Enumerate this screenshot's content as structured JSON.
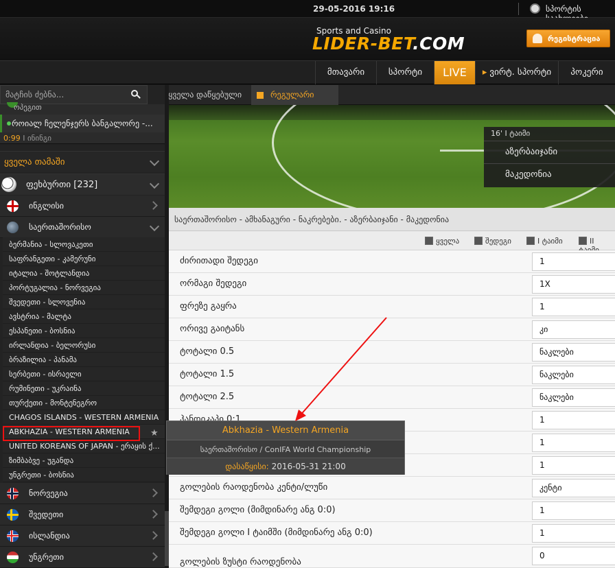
{
  "topbar": {
    "datetime": "29-05-2016 19:16",
    "sports_score": "სპორტის საახლეები"
  },
  "header": {
    "logo_sub": "Sports and Casino",
    "logo_main": "LIDER-BET",
    "logo_com": ".COM",
    "register": "რეგისტრაცია"
  },
  "nav": {
    "items": [
      "მთავარი",
      "სპორტი",
      "LIVE",
      "ვირტ. სპორტი",
      "პოკერი"
    ]
  },
  "search": {
    "placeholder": "მატჩის ძებნა..."
  },
  "filter": {
    "all_sorted": "ყველა დაწყებული",
    "regular": "რეგულარი თამაში"
  },
  "live": {
    "prev": "ოპეგით",
    "match": "როიალ ჩელენჯერს ბანგალორე -...",
    "odds_val": "0:99",
    "odds_suffix": "I ინინგი"
  },
  "sidebar": {
    "all_games": "ყველა თამაში",
    "football": "ფეხბურთი [232]",
    "england": "ინგლისი",
    "international": "საერთაშორისო",
    "matches": [
      "ბერმანია - სლოვაკეთი",
      "საფრანგეთი - კამერუნი",
      "იტალია - შოტლანდია",
      "პორტუგალია - ნორვეგია",
      "შვედეთი - სლოვენია",
      "ავსტრია - მალტა",
      "ესპანეთი - ბოსნია",
      "ირლანდია - ბელორუსი",
      "ბრაზილია - პანამა",
      "სერბეთი - ისრაელი",
      "რუმინეთი - უკრაინა",
      "თურქეთი - მონტენეგრო",
      "CHAGOS ISLANDS - WESTERN ARMENIA",
      "ABKHAZIA - WESTERN ARMENIA",
      "UNITED KOREANS OF JAPAN - ერაყის ქ...",
      "ზიმბაბვე - უგანდა",
      "უნგრეთი - ბოსნია"
    ],
    "norway": "ნორვეგია",
    "sweden": "შვედეთი",
    "iceland": "ისლანდია",
    "hungary": "უნგრეთი"
  },
  "scoreboard": {
    "time": "16'  I ტაიმი",
    "team1": "აზერბაიჯანი",
    "team2": "მაკედონია"
  },
  "breadcrumb": "საერთაშორისო - ამხანაგური - ნაკრებები. - აზერბაიჯანი - მაკედონია",
  "checks": [
    "ყველა",
    "შედეგი",
    "I ტაიმი",
    "II ტაიმი"
  ],
  "markets": [
    {
      "label": "ძირითადი შედეგი",
      "value": "1"
    },
    {
      "label": "ორმაგი შედეგი",
      "value": "1X"
    },
    {
      "label": "ფრეზე გაყრა",
      "value": "1"
    },
    {
      "label": "ორივე გაიტანს",
      "value": "კი"
    },
    {
      "label": "ტოტალი 0.5",
      "value": "ნაკლები"
    },
    {
      "label": "ტოტალი 1.5",
      "value": "ნაკლები"
    },
    {
      "label": "ტოტალი 2.5",
      "value": "ნაკლები"
    },
    {
      "label": "ჰანდიკაპი 0:1",
      "value": "1"
    },
    {
      "label": "",
      "value": "1"
    },
    {
      "label": "",
      "value": "1"
    },
    {
      "label": "გოლების რაოდენობა კენტი/ლუწი",
      "value": "კენტი"
    },
    {
      "label": "შემდეგი გოლი (მიმდინარე ანგ 0:0)",
      "value": "1"
    },
    {
      "label": "შემდეგი გოლი I ტაიმში (მიმდინარე ანგ 0:0)",
      "value": "1"
    },
    {
      "label": "გოლების ზუსტი რაოდენობა",
      "value": "0"
    }
  ],
  "tooltip": {
    "title": "Abkhazia - Western Armenia",
    "subtitle": "საერთაშორისო / ConIFA World Championship",
    "start_label": "დასაწყისი:",
    "start_value": "2016-05-31 21:00"
  },
  "colors": {
    "accent": "#f5a623",
    "highlight": "#e11111"
  }
}
